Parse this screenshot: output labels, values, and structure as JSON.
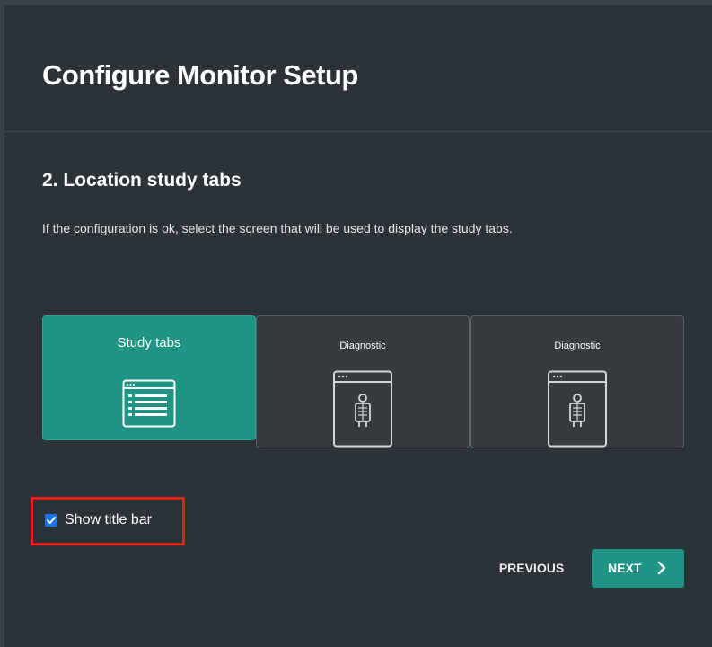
{
  "dialog": {
    "title": "Configure Monitor Setup",
    "section_title": "2. Location study tabs",
    "description": "If the configuration is ok, select the screen that will be used to display the study tabs."
  },
  "screens": [
    {
      "label": "Study tabs",
      "icon": "study-tabs-window-icon",
      "selected": true
    },
    {
      "label": "Diagnostic",
      "icon": "xray-window-icon",
      "selected": false
    },
    {
      "label": "Diagnostic",
      "icon": "xray-window-icon",
      "selected": false
    }
  ],
  "options": {
    "show_title_bar_label": "Show title bar",
    "show_title_bar_checked": true
  },
  "buttons": {
    "previous": "PREVIOUS",
    "next": "NEXT"
  },
  "colors": {
    "background": "#2b3238",
    "accent": "#1f9485",
    "screen_bg": "#363b40",
    "highlight_box": "#e2231a",
    "checkbox": "#1a73e8"
  }
}
